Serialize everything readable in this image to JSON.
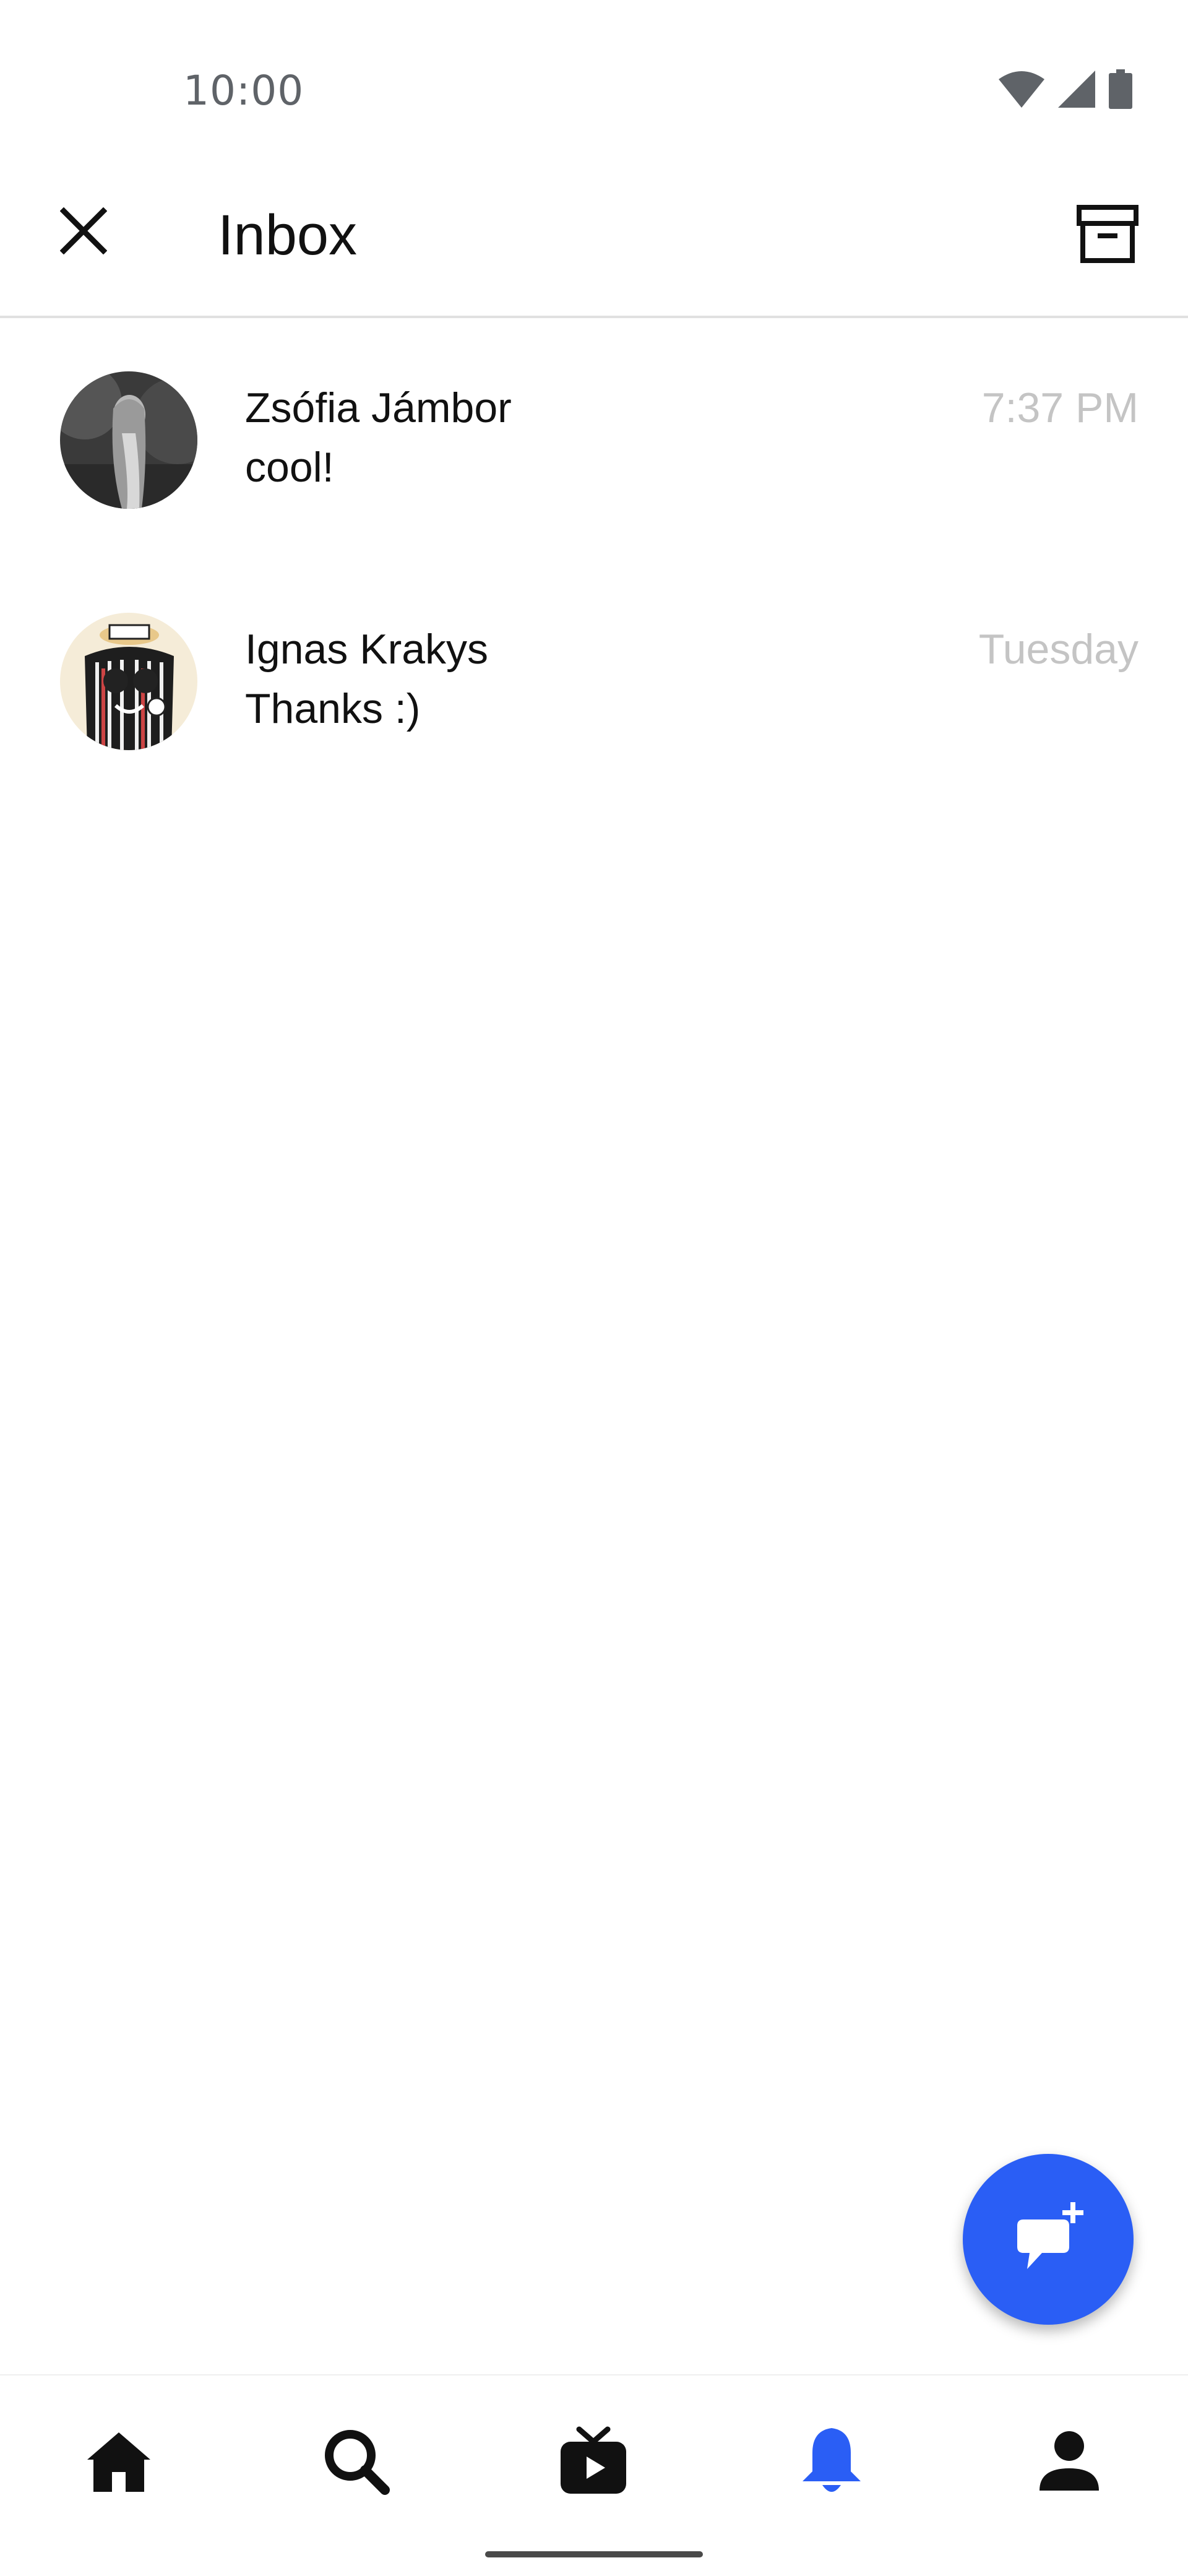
{
  "status_bar": {
    "time": "10:00"
  },
  "app_bar": {
    "title": "Inbox",
    "close_icon": "close-icon",
    "archive_icon": "archive-icon"
  },
  "conversations": [
    {
      "name": "Zsófia Jámbor",
      "message": "cool!",
      "time": "7:37 PM"
    },
    {
      "name": "Ignas Krakys",
      "message": "Thanks :)",
      "time": "Tuesday"
    }
  ],
  "fab": {
    "icon": "new-message-icon",
    "color": "#2a5ef5"
  },
  "bottom_nav": {
    "items": [
      {
        "icon": "home-icon",
        "active": false
      },
      {
        "icon": "search-icon",
        "active": false
      },
      {
        "icon": "tv-icon",
        "active": false
      },
      {
        "icon": "bell-icon",
        "active": true
      },
      {
        "icon": "profile-icon",
        "active": false
      }
    ],
    "active_color": "#2a5ef5"
  }
}
